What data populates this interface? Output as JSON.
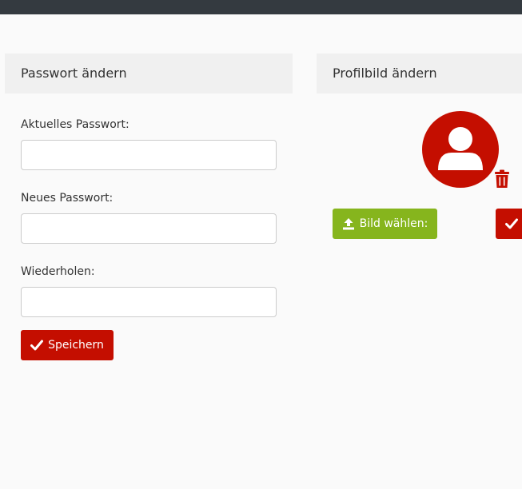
{
  "password_panel": {
    "title": "Passwort ändern",
    "current_label": "Aktuelles Passwort:",
    "current_value": "",
    "new_label": "Neues Passwort:",
    "new_value": "",
    "repeat_label": "Wiederholen:",
    "repeat_value": "",
    "save_label": "Speichern",
    "save_icon": "check-icon"
  },
  "picture_panel": {
    "title": "Profilbild ändern",
    "avatar_icon": "user-icon",
    "delete_icon": "trash-icon",
    "choose_label": "Bild wählen:",
    "choose_icon": "upload-icon",
    "confirm_icon": "check-icon"
  },
  "colors": {
    "primary_red": "#c40e00",
    "accent_green": "#86b51d",
    "topbar": "#343a40"
  }
}
